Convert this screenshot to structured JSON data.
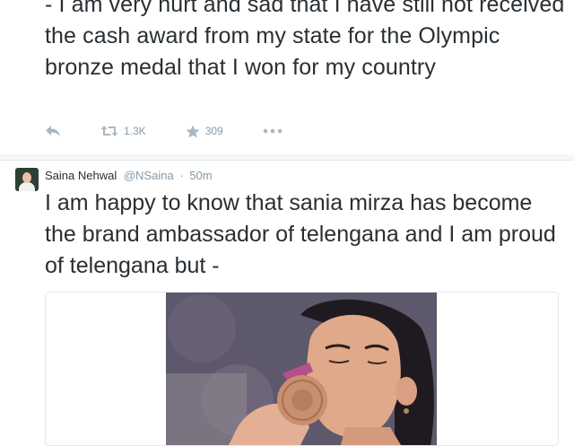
{
  "tweet1": {
    "text": "- I am very hurt and sad that I have still not received the cash award from my state for the Olympic bronze medal that I won for my country",
    "actions": {
      "reply_icon": "reply-icon",
      "retweet_icon": "retweet-icon",
      "retweet_count": "1.3K",
      "favorite_icon": "star-icon",
      "favorite_count": "309",
      "more_icon": "more-icon"
    }
  },
  "tweet2": {
    "author_name": "Saina Nehwal",
    "handle": "@NSaina",
    "separator": "·",
    "time": "50m",
    "text": "I am happy to know that sania mirza has become the brand ambassador of telengana and I am proud of telengana but -",
    "media": "photo of Saina Nehwal kissing her bronze medal"
  },
  "colors": {
    "text": "#292f33",
    "muted": "#8899a6",
    "border": "#e1e8ed",
    "medal": "#c9906f"
  }
}
